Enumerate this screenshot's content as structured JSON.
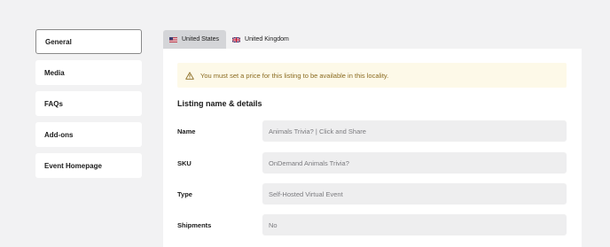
{
  "sidebar": {
    "items": [
      {
        "label": "General"
      },
      {
        "label": "Media"
      },
      {
        "label": "FAQs"
      },
      {
        "label": "Add-ons"
      },
      {
        "label": "Event Homepage"
      }
    ],
    "active": "General"
  },
  "tabs": [
    {
      "label": "United States",
      "icon": "us-flag-icon"
    },
    {
      "label": "United Kingdom",
      "icon": "uk-flag-icon"
    }
  ],
  "notice": {
    "text": "You must set a price for this listing to be available in this locality.",
    "icon": "warning-icon",
    "color": "#8a6a1f",
    "background": "#fdf9e8"
  },
  "section": {
    "title": "Listing name & details"
  },
  "fields": [
    {
      "label": "Name",
      "value": "Animals Trivia? | Click and Share"
    },
    {
      "label": "SKU",
      "value": "OnDemand Animals Trivia?"
    },
    {
      "label": "Type",
      "value": "Self-Hosted Virtual Event"
    },
    {
      "label": "Shipments",
      "value": "No"
    }
  ]
}
